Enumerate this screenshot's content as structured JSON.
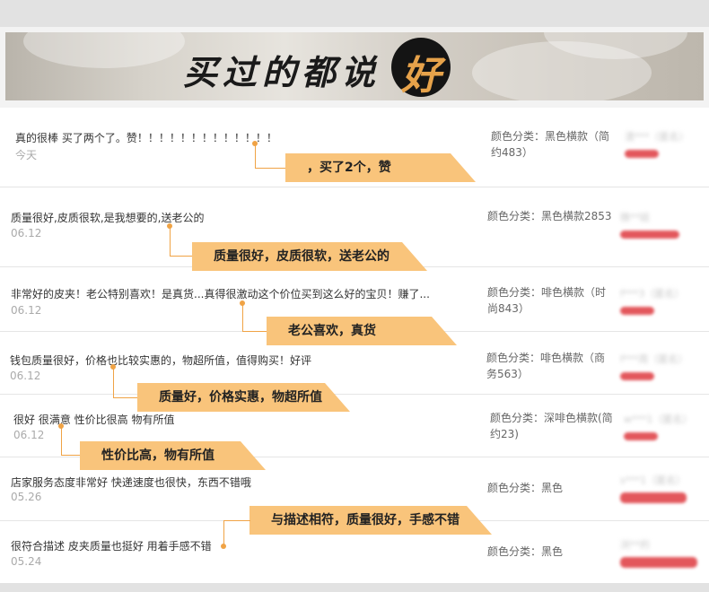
{
  "banner": {
    "title": "买过的都说",
    "badge": "好"
  },
  "reviews": [
    {
      "comment": "真的很棒 买了两个了。赞！！！！！！！！！！！！！",
      "date": "今天",
      "attr": "颜色分类：黑色横款（简约483）",
      "user": "渣***（匿名）",
      "callout": "，买了2个，赞"
    },
    {
      "comment": "质量很好,皮质很软,是我想要的,送老公的",
      "date": "06.12",
      "attr": "颜色分类：黑色横款2853",
      "user": "微**娃",
      "callout": "质量很好，皮质很软，送老公的"
    },
    {
      "comment": "非常好的皮夹！老公特别喜欢！是真货...真得很激动这个价位买到这么好的宝贝！赚了...",
      "date": "06.12",
      "attr": "颜色分类：啡色横款（时尚843）",
      "user": "f***3（匿名）",
      "callout": "老公喜欢，真货"
    },
    {
      "comment": "钱包质量很好，价格也比较实惠的，物超所值，值得购买！好评",
      "date": "06.12",
      "attr": "颜色分类：啡色横款（商务563）",
      "user": "f***周（匿名）",
      "callout": "质量好，价格实惠，物超所值"
    },
    {
      "comment": "很好 很满意 性价比很高 物有所值",
      "date": "06.12",
      "attr": "颜色分类：深啡色横款(简约23)",
      "user": "w***1（匿名）",
      "callout": "性价比高，物有所值"
    },
    {
      "comment": "店家服务态度非常好 快递速度也很快，东西不错哦",
      "date": "05.26",
      "attr": "颜色分类：黑色",
      "user": "s***1（匿名）",
      "callout": ""
    },
    {
      "comment": "很符合描述 皮夹质量也挺好 用着手感不错",
      "date": "05.24",
      "attr": "颜色分类：黑色",
      "user": "浏**的",
      "callout": "与描述相符，质量很好，手感不错"
    }
  ],
  "colors": {
    "accent": "#f9c47b",
    "line": "#f0a345",
    "rating": "#e3575c"
  }
}
